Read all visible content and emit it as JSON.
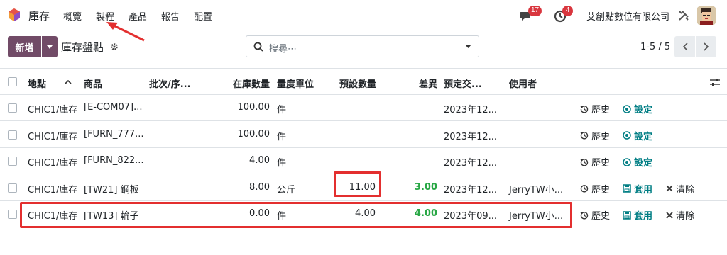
{
  "nav": {
    "app_name": "庫存",
    "menus": [
      "概覽",
      "製程",
      "產品",
      "報告",
      "配置"
    ],
    "chat_count": "17",
    "activity_count": "4",
    "company": "艾創點數位有限公司"
  },
  "control": {
    "new_label": "新增",
    "title": "庫存盤點",
    "search_placeholder": "搜尋⋯",
    "pager": "1-5 / 5"
  },
  "table": {
    "headers": {
      "location": "地點",
      "product": "商品",
      "lot": "批次/序...",
      "on_hand": "在庫數量",
      "uom": "量度單位",
      "counted": "預設數量",
      "difference": "差異",
      "scheduled": "預定交...",
      "user": "使用者"
    },
    "rows": [
      {
        "location": "CHIC1/庫存",
        "product": "[E-COM07]...",
        "on_hand": "100.00",
        "uom": "件",
        "counted": "",
        "difference": "",
        "scheduled": "2023年12...",
        "user": "",
        "act1": "歷史",
        "act2": "設定",
        "act3": ""
      },
      {
        "location": "CHIC1/庫存",
        "product": "[FURN_777...",
        "on_hand": "100.00",
        "uom": "件",
        "counted": "",
        "difference": "",
        "scheduled": "2023年12...",
        "user": "",
        "act1": "歷史",
        "act2": "設定",
        "act3": ""
      },
      {
        "location": "CHIC1/庫存",
        "product": "[FURN_822...",
        "on_hand": "4.00",
        "uom": "件",
        "counted": "",
        "difference": "",
        "scheduled": "2023年12...",
        "user": "",
        "act1": "歷史",
        "act2": "設定",
        "act3": ""
      },
      {
        "location": "CHIC1/庫存",
        "product": "[TW21] 鋼板",
        "on_hand": "8.00",
        "uom": "公斤",
        "counted": "11.00",
        "difference": "3.00",
        "scheduled": "2023年12...",
        "user": "JerryTW小...",
        "act1": "歷史",
        "act2": "套用",
        "act3": "清除"
      },
      {
        "location": "CHIC1/庫存",
        "product": "[TW13] 輪子",
        "on_hand": "0.00",
        "uom": "件",
        "counted": "4.00",
        "difference": "4.00",
        "scheduled": "2023年09...",
        "user": "JerryTW小...",
        "act1": "歷史",
        "act2": "套用",
        "act3": "清除"
      }
    ]
  },
  "colors": {
    "brand": "#714b67",
    "accent": "#017e84",
    "badge": "#d9363e",
    "positive": "#28a745",
    "highlight": "#e32f2f"
  }
}
